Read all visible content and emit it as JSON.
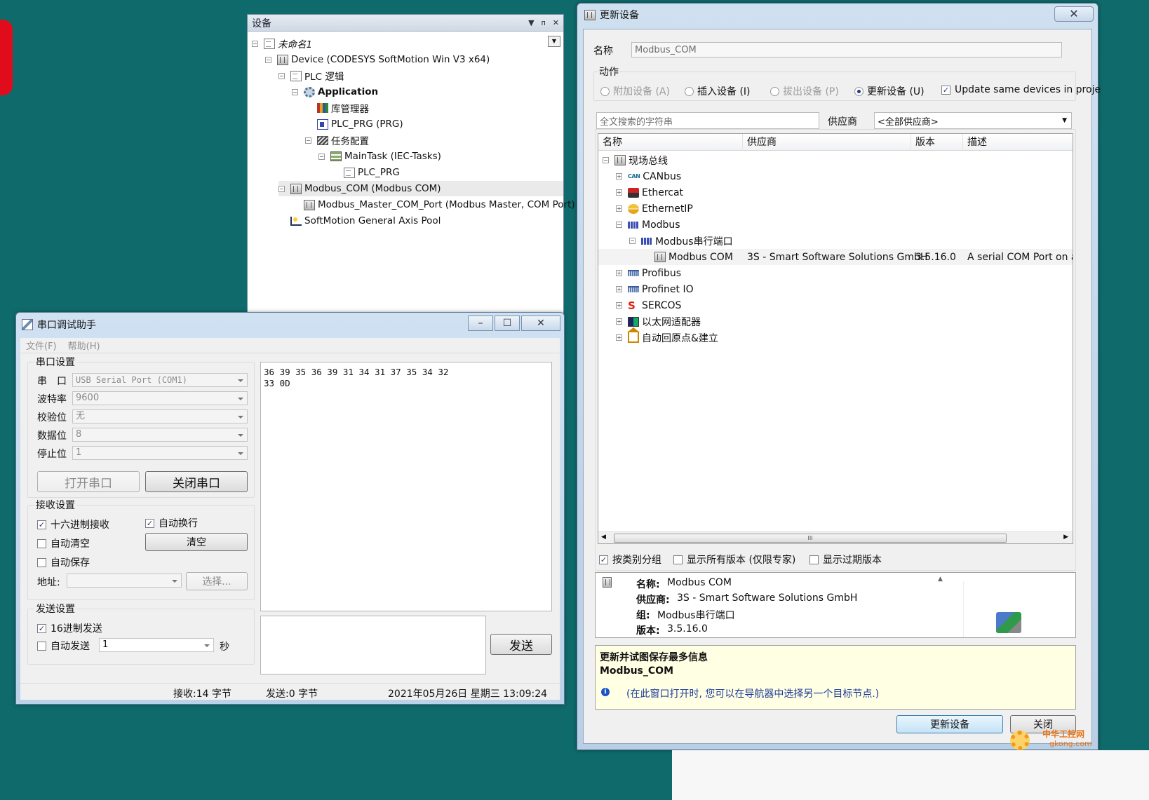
{
  "devices_panel": {
    "title": "设备",
    "tree": [
      {
        "label": "未命名1",
        "icon": "project-icon",
        "level": 0,
        "expander": "−"
      },
      {
        "label": "Device (CODESYS SoftMotion Win V3 x64)",
        "icon": "device-icon",
        "level": 1,
        "expander": "−"
      },
      {
        "label": "PLC 逻辑",
        "icon": "plc-logic-icon",
        "level": 2,
        "expander": "−"
      },
      {
        "label": "Application",
        "icon": "application-gear-icon",
        "level": 3,
        "expander": "−"
      },
      {
        "label": "库管理器",
        "icon": "library-manager-icon",
        "level": 4
      },
      {
        "label": "PLC_PRG (PRG)",
        "icon": "prg-icon",
        "level": 4
      },
      {
        "label": "任务配置",
        "icon": "task-config-icon",
        "level": 4,
        "expander": "−"
      },
      {
        "label": "MainTask (IEC-Tasks)",
        "icon": "task-icon",
        "level": 5,
        "expander": "−"
      },
      {
        "label": "PLC_PRG",
        "icon": "prg-call-icon",
        "level": 6
      },
      {
        "label": "Modbus_COM (Modbus COM)",
        "icon": "device-icon",
        "level": 2,
        "expander": "−",
        "selected": true
      },
      {
        "label": "Modbus_Master_COM_Port (Modbus Master, COM Port)",
        "icon": "device-icon",
        "level": 3
      },
      {
        "label": "SoftMotion General Axis Pool",
        "icon": "axis-pool-icon",
        "level": 2
      }
    ]
  },
  "update_dialog": {
    "title": "更新设备",
    "name_label": "名称",
    "name_value": "Modbus_COM",
    "action_label": "动作",
    "actions": [
      {
        "label": "附加设备 (A)",
        "selected": false,
        "enabled": false
      },
      {
        "label": "插入设备 (I)",
        "selected": false,
        "enabled": true
      },
      {
        "label": "拔出设备 (P)",
        "selected": false,
        "enabled": false
      },
      {
        "label": "更新设备 (U)",
        "selected": true,
        "enabled": true
      }
    ],
    "update_same_label": "Update same devices in proje",
    "search_placeholder": "全文搜索的字符串",
    "vendor_label": "供应商",
    "vendor_value": "<全部供应商>",
    "columns": [
      "名称",
      "供应商",
      "版本",
      "描述"
    ],
    "rows": [
      {
        "name": "现场总线",
        "icon": "fieldbus-icon",
        "level": 0,
        "expander": "−"
      },
      {
        "name": "CANbus",
        "icon": "canbus-icon",
        "level": 1,
        "expander": "+",
        "icon_text": "CAN"
      },
      {
        "name": "Ethercat",
        "icon": "ethercat-icon",
        "level": 1,
        "expander": "+"
      },
      {
        "name": "EthernetIP",
        "icon": "ethernetip-icon",
        "level": 1,
        "expander": "+"
      },
      {
        "name": "Modbus",
        "icon": "modbus-icon",
        "level": 1,
        "expander": "−"
      },
      {
        "name": "Modbus串行端口",
        "icon": "modbus-serial-icon",
        "level": 2,
        "expander": "−"
      },
      {
        "name": "Modbus COM",
        "icon": "device-icon",
        "level": 3,
        "vendor": "3S - Smart Software Solutions GmbH",
        "version": "3.5.16.0",
        "description": "A serial COM Port on a Wi",
        "selected": true
      },
      {
        "name": "Profibus",
        "icon": "profibus-icon",
        "level": 1,
        "expander": "+"
      },
      {
        "name": "Profinet IO",
        "icon": "profinet-icon",
        "level": 1,
        "expander": "+"
      },
      {
        "name": "SERCOS",
        "icon": "sercos-icon",
        "level": 1,
        "expander": "+",
        "icon_text": "S"
      },
      {
        "name": "以太网适配器",
        "icon": "ethernet-adapter-icon",
        "level": 1,
        "expander": "+"
      },
      {
        "name": "自动回原点&建立",
        "icon": "homing-icon",
        "level": 1,
        "expander": "+"
      }
    ],
    "scroll_thumb": "III",
    "options": [
      {
        "label": "按类别分组",
        "checked": true
      },
      {
        "label": "显示所有版本 (仅限专家)",
        "checked": false
      },
      {
        "label": "显示过期版本",
        "checked": false
      }
    ],
    "info": {
      "name_label": "名称:",
      "name": "Modbus COM",
      "vendor_label": "供应商:",
      "vendor": "3S - Smart Software Solutions GmbH",
      "group_label": "组:",
      "group": "Modbus串行端口",
      "version_label": "版本:",
      "version": "3.5.16.0"
    },
    "hint_title": "更新并试图保存最多信息",
    "hint_node": "Modbus_COM",
    "hint_text": "(在此窗口打开时, 您可以在导航器中选择另一个目标节点.)",
    "buttons": {
      "update": "更新设备",
      "close": "关闭"
    }
  },
  "serial_tool": {
    "title": "串口调试助手",
    "menu": [
      "文件(F)",
      "帮助(H)"
    ],
    "port_group": "串口设置",
    "fields": [
      {
        "label": "串　口",
        "value": "USB Serial Port (COM1)"
      },
      {
        "label": "波特率",
        "value": "9600"
      },
      {
        "label": "校验位",
        "value": "无"
      },
      {
        "label": "数据位",
        "value": "8"
      },
      {
        "label": "停止位",
        "value": "1"
      }
    ],
    "open_button": "打开串口",
    "close_button": "关闭串口",
    "recv_group": "接收设置",
    "hex_recv": {
      "label": "十六进制接收",
      "checked": true
    },
    "auto_newline": {
      "label": "自动换行",
      "checked": true
    },
    "auto_clear": {
      "label": "自动清空",
      "checked": false
    },
    "clear_button": "清空",
    "auto_save": {
      "label": "自动保存",
      "checked": false
    },
    "address_label": "地址:",
    "browse_button": "选择...",
    "send_group": "发送设置",
    "hex_send": {
      "label": "16进制发送",
      "checked": true
    },
    "auto_send": {
      "label": "自动发送",
      "checked": false
    },
    "interval_value": "1",
    "interval_unit": "秒",
    "send_button": "发送",
    "received_data": "36 39 35 36 39 31 34 31 37 35 34 32\n33 0D",
    "status": {
      "received": "接收:14 字节",
      "sent": "发送:0 字节",
      "datetime": "2021年05月26日 星期三 13:09:24"
    }
  },
  "watermark": {
    "line1": "中华工控网",
    "line2": "gkong.com"
  }
}
